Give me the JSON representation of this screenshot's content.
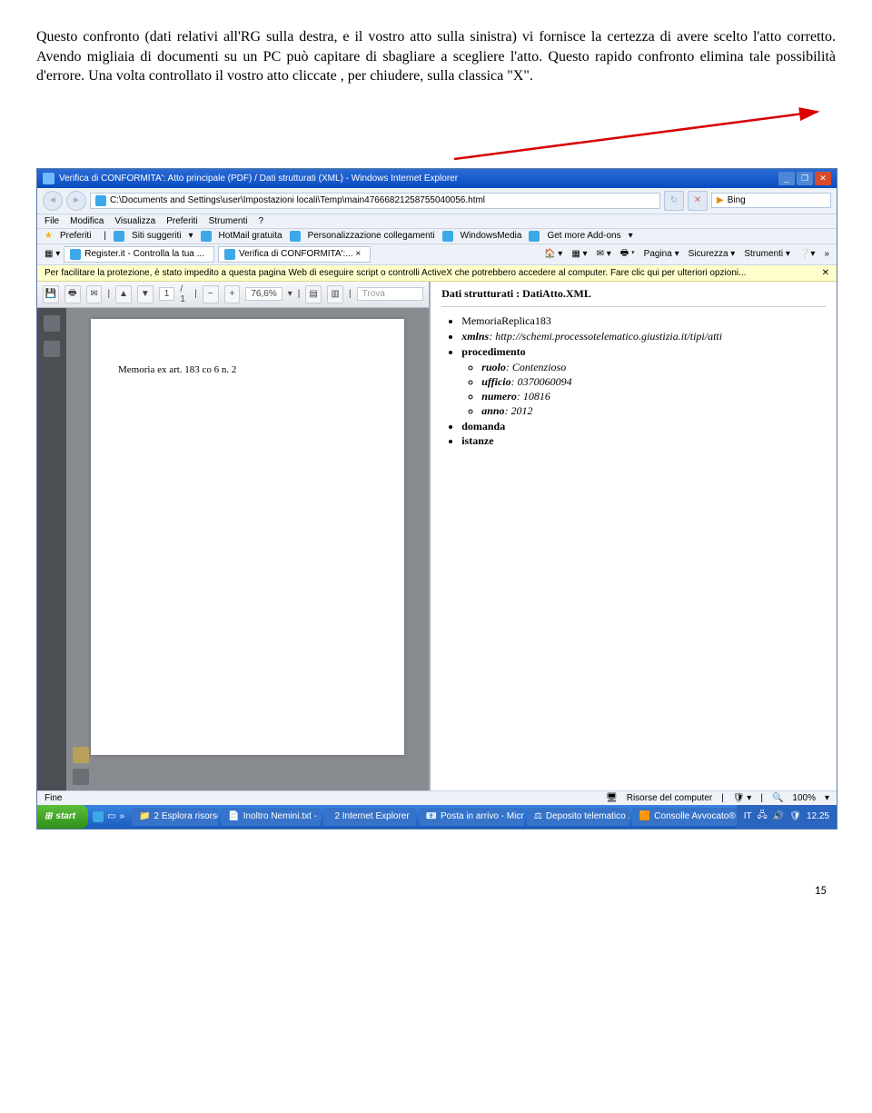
{
  "paragraph": "Questo confronto (dati relativi all'RG sulla destra, e il vostro atto sulla sinistra) vi fornisce la certezza di avere scelto l'atto corretto. Avendo migliaia di documenti su un PC può capitare di sbagliare a scegliere l'atto. Questo rapido confronto elimina tale possibilità d'errore. Una volta controllato il vostro atto cliccate , per chiudere, sulla classica \"X\".",
  "ie": {
    "title": "Verifica di CONFORMITA': Atto principale (PDF) / Dati strutturati (XML) - Windows Internet Explorer",
    "address": "C:\\Documents and Settings\\user\\Impostazioni locali\\Temp\\main47666821258755040056.html",
    "search_engine": "Bing",
    "menu": [
      "File",
      "Modifica",
      "Visualizza",
      "Preferiti",
      "Strumenti",
      "?"
    ],
    "fav_label": "Preferiti",
    "fav_links": [
      "Siti suggeriti",
      "HotMail gratuita",
      "Personalizzazione collegamenti",
      "WindowsMedia",
      "Get more Add-ons"
    ],
    "tabs": [
      "Register.it - Controlla la tua ...",
      "Verifica di CONFORMITA':... ×"
    ],
    "cmdbar": [
      "Pagina",
      "Sicurezza",
      "Strumenti"
    ],
    "infobar": "Per facilitare la protezione, è stato impedito a questa pagina Web di eseguire script o controlli ActiveX che potrebbero accedere al computer. Fare clic qui per ulteriori opzioni...",
    "status_left": "Fine",
    "status_mid": "Risorse del computer",
    "status_zoom": "100%"
  },
  "pdf": {
    "page_current": "1",
    "page_total": "/ 1",
    "zoom": "76,6%",
    "find_placeholder": "Trova",
    "doc_text": "Memoria ex art. 183 co 6 n. 2"
  },
  "xml": {
    "header": "Dati strutturati : DatiAtto.XML",
    "root": "MemoriaReplica183",
    "xmlns_label": "xmlns",
    "xmlns_value": ": http://schemi.processotelematico.giustizia.it/tipi/atti",
    "proc_label": "procedimento",
    "ruolo_label": "ruolo",
    "ruolo_value": ": Contenzioso",
    "ufficio_label": "ufficio",
    "ufficio_value": ": 0370060094",
    "numero_label": "numero",
    "numero_value": ": 10816",
    "anno_label": "anno",
    "anno_value": ": 2012",
    "domanda": "domanda",
    "istanze": "istanze"
  },
  "taskbar": {
    "start": "start",
    "items": [
      "2 Esplora risorse",
      "Inoltro Nemini.txt - ...",
      "2 Internet Explorer",
      "Posta in arrivo - Micr...",
      "Deposito telematico ...",
      "Consolle Avvocato®..."
    ],
    "lang": "IT",
    "time": "12.25"
  },
  "pagenum": "15"
}
